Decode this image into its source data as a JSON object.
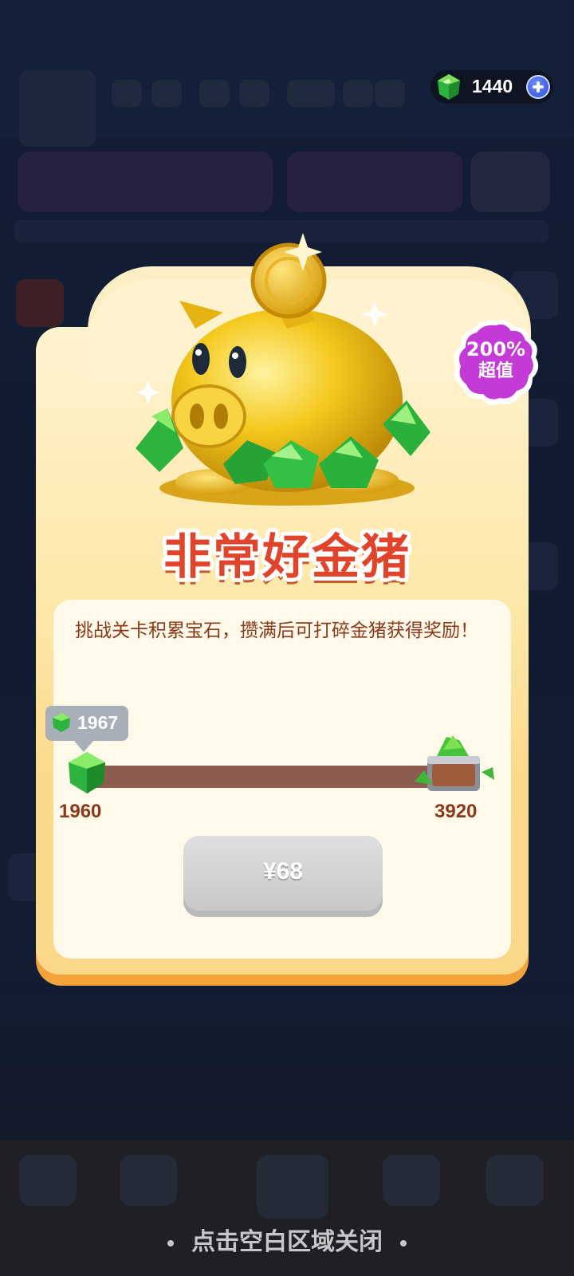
{
  "currency": {
    "gem_count": "1440",
    "icon": "gem-icon",
    "add_icon": "plus-icon"
  },
  "popup": {
    "title": "非常好金猪",
    "badge": {
      "percent": "200%",
      "label": "超值"
    },
    "description": "挑战关卡积累宝石，攒满后可打碎金猪获得奖励！",
    "progress": {
      "current": "1967",
      "min": "1960",
      "max": "3920",
      "fraction": 0.0036
    },
    "price_button": "¥68",
    "close_hint": "点击空白区域关闭"
  },
  "colors": {
    "title": "#e0442a",
    "text": "#8a3a1c",
    "card_border": "#f2a33c",
    "badge": "#c33ad6",
    "button_disabled": "#d2d2d2"
  }
}
